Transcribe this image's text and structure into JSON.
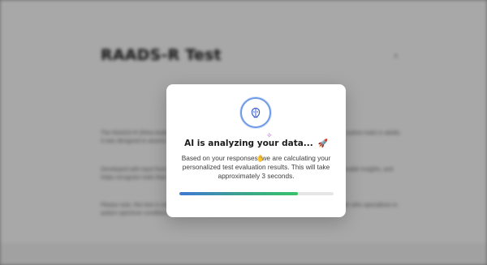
{
  "background": {
    "title": "RAADS-R Test",
    "icon": "arrow-left-icon",
    "paragraphs": [
      "The RAADS-R (Ritvo Autism Asperger Diagnostic Scale-Revised) is a clinical tool used to identify autism traits in adults. It was designed to assess individuals of all ages, from young children to adults.",
      "Developed with input from clinicians, it combines self-report with clinician reflection and offer actionable insights, and helps recognize traits that may otherwise be overlooking a professional evaluation.",
      "Please note, this test is not a diagnostic tool. For an official diagnosis, consult a healthcare provider who specializes in autism spectrum conditions for a more in-depth assessment."
    ]
  },
  "modal": {
    "icon": "brain-icon",
    "sparkle_icon": "sparkle-icon",
    "title": "AI is analyzing your data...",
    "title_emoji": "🚀",
    "description": "Based on your responses, we are calculating your personalized test evaluation results. This will take approximately 3 seconds.",
    "progress_percent": 77,
    "colors": {
      "progress_start": "#3f78d6",
      "progress_end": "#38c46a",
      "ring": "#6f9ae6"
    }
  }
}
